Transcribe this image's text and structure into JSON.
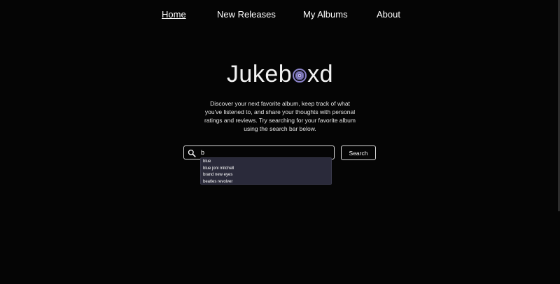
{
  "nav": {
    "items": [
      {
        "label": "Home",
        "active": true
      },
      {
        "label": "New Releases",
        "active": false
      },
      {
        "label": "My Albums",
        "active": false
      },
      {
        "label": "About",
        "active": false
      }
    ]
  },
  "logo": {
    "prefix": "Jukeb",
    "suffix": "xd",
    "icon": "vinyl-disc-icon"
  },
  "description": "Discover your next favorite album, keep track of what you've listened to, and share your thoughts with personal ratings and reviews. Try searching for your favorite album using the search bar below.",
  "search": {
    "value": "b",
    "placeholder": "",
    "button_label": "Search",
    "icon": "search-icon"
  },
  "suggestions": [
    "blue",
    "blue joni mitchell",
    "brand new eyes",
    "beatles revolver"
  ],
  "colors": {
    "background": "#050505",
    "text": "#ffffff",
    "suggestion_bg": "#2a2a3a",
    "disc_accent": "#8a82c8"
  }
}
